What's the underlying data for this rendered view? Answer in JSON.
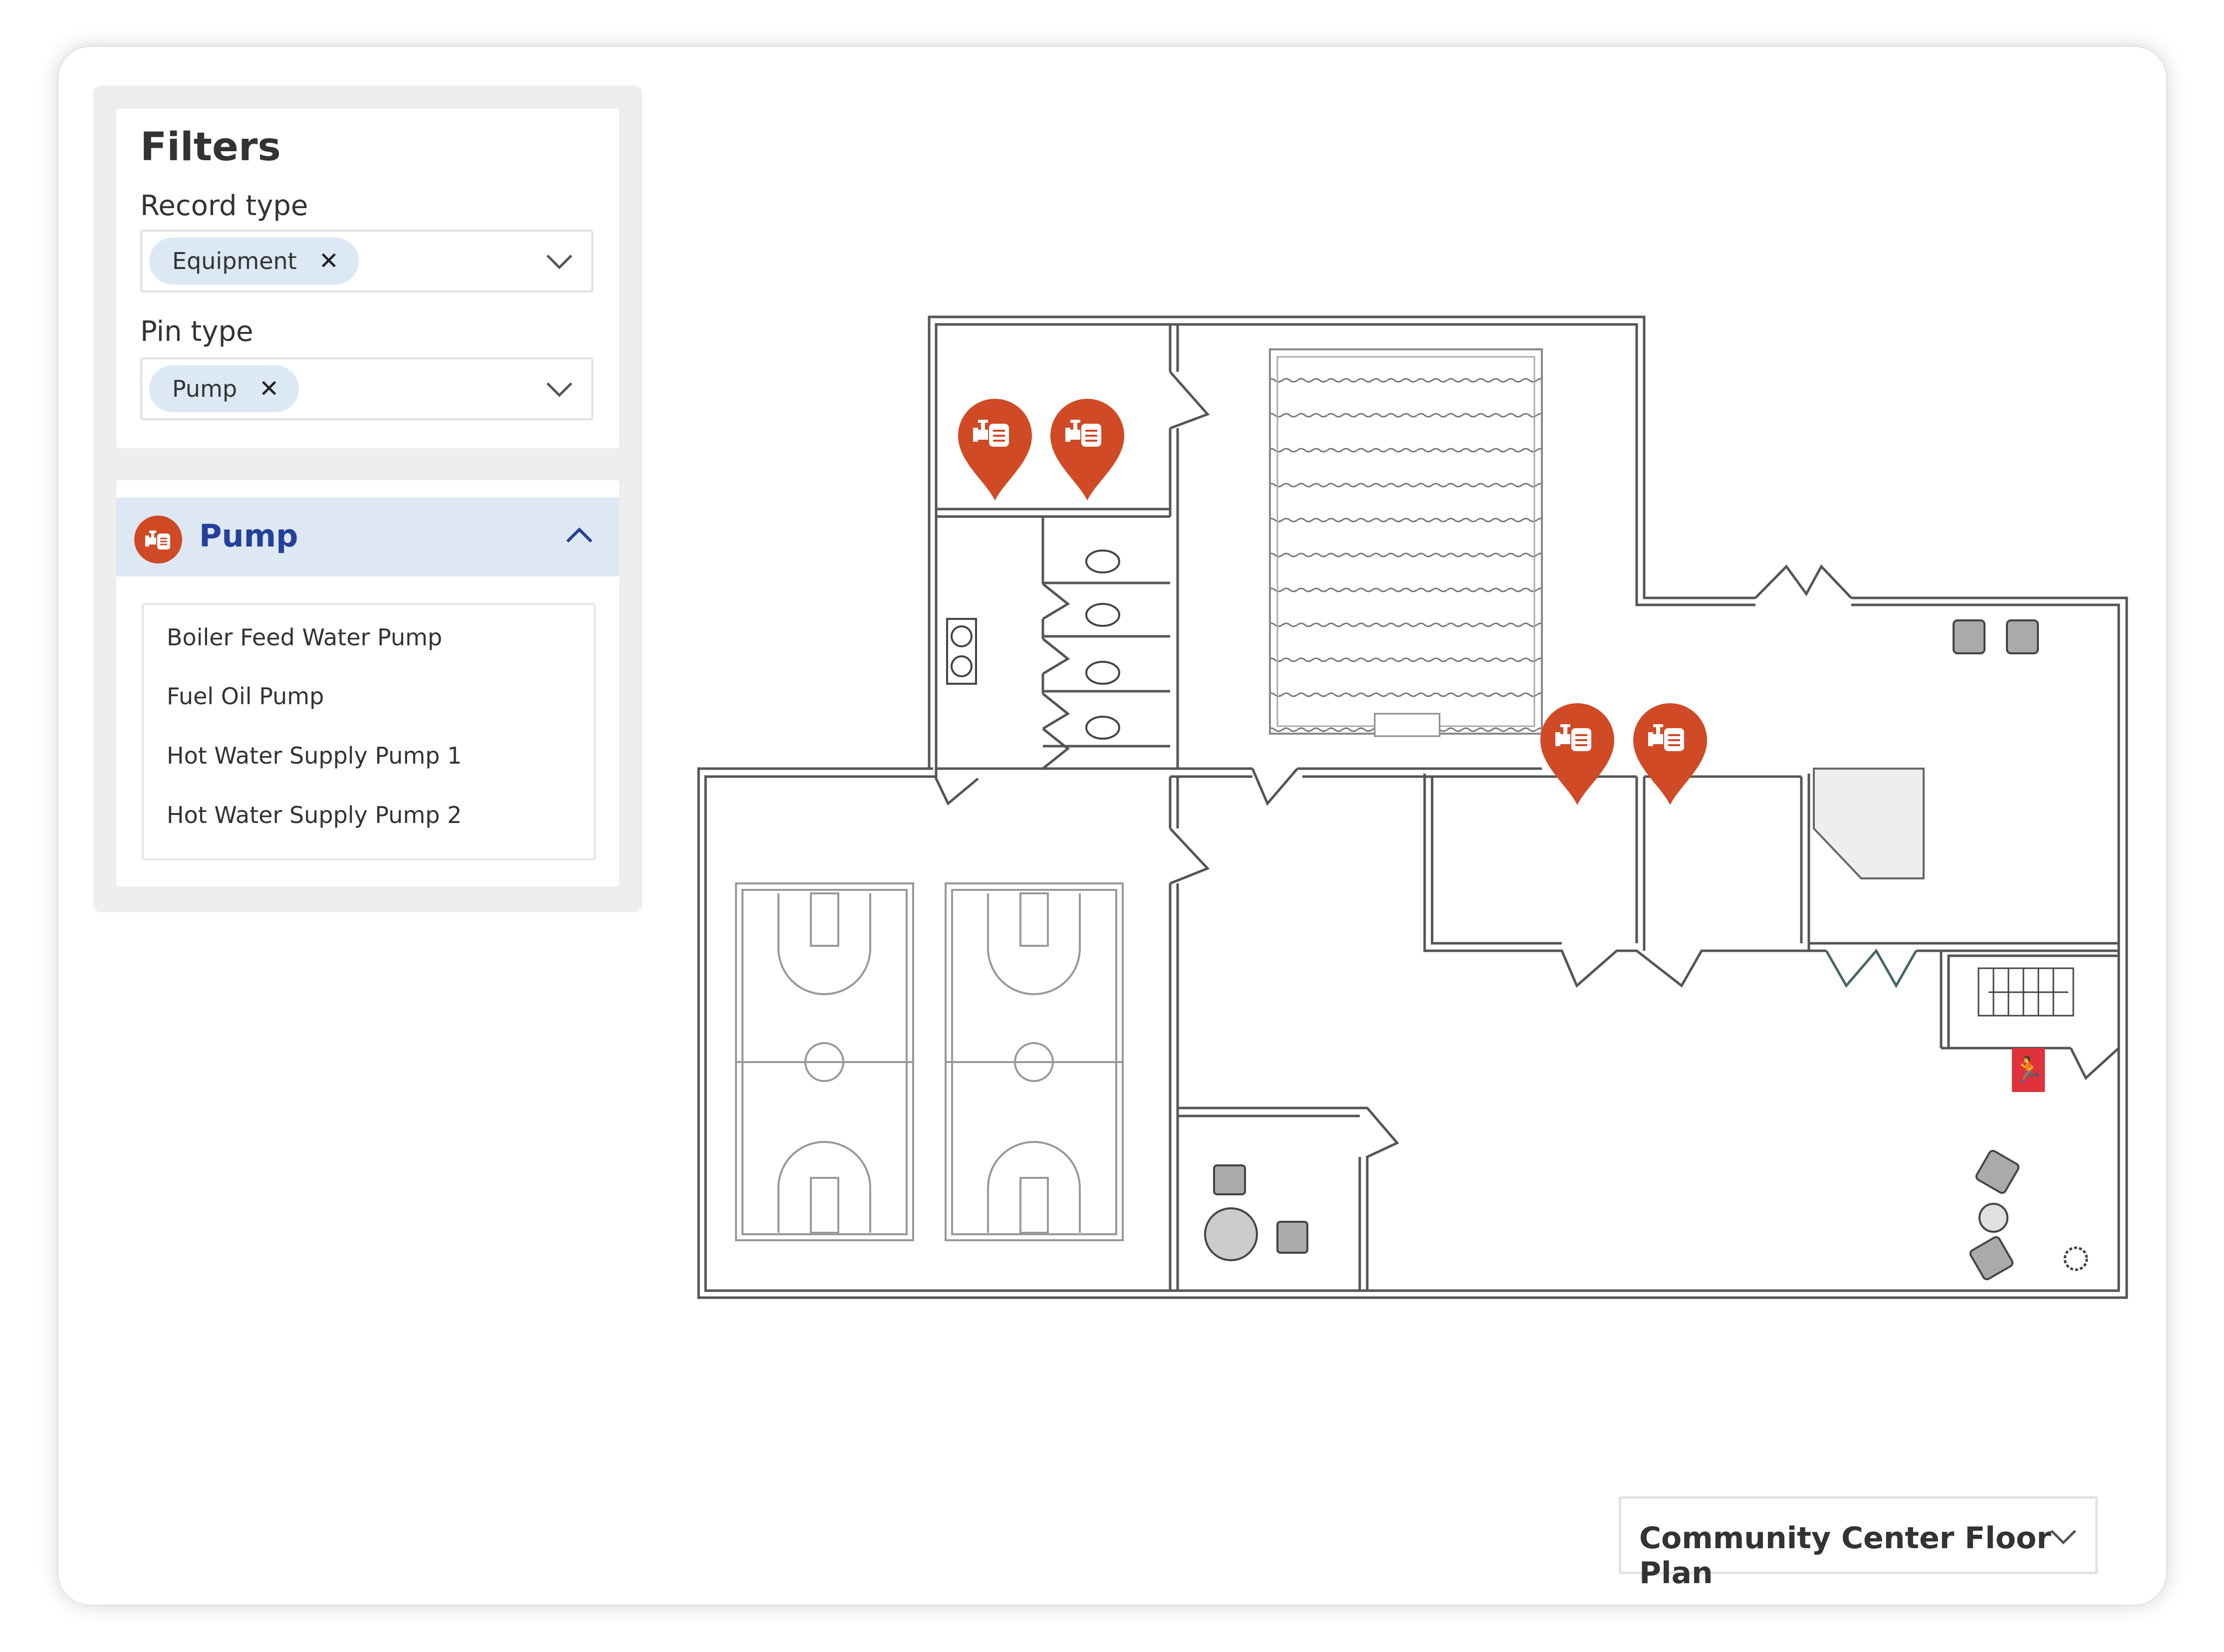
{
  "filters": {
    "title": "Filters",
    "record_type_label": "Record type",
    "record_type_value": "Equipment",
    "pin_type_label": "Pin type",
    "pin_type_value": "Pump",
    "remove_icon_glyph": "✕"
  },
  "pump_group": {
    "title": "Pump",
    "icon": "pump-icon",
    "expanded": true,
    "items": [
      "Boiler Feed Water Pump",
      "Fuel Oil Pump",
      "Hot Water Supply Pump 1",
      "Hot Water Supply Pump 2"
    ]
  },
  "floor_plan": {
    "selected": "Community Center Floor Plan",
    "pin_icon": "pump-icon",
    "pin_count": 4
  },
  "colors": {
    "accent": "#cf4a25",
    "header_bg": "#dde8f3",
    "chip_bg": "#dce8f3",
    "title_blue": "#23409a",
    "exit_sign": "#e0323a"
  }
}
